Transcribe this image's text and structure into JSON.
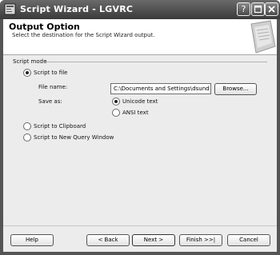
{
  "window": {
    "title": "Script Wizard - LGVRC"
  },
  "header": {
    "title": "Output Option",
    "subtitle": "Select the destination for the Script Wizard output."
  },
  "script_mode": {
    "group_label": "Script mode",
    "options": {
      "to_file": "Script to file",
      "to_clipboard": "Script to Clipboard",
      "to_query_window": "Script to New Query Window"
    },
    "selected": "to_file",
    "file_name_label": "File name:",
    "file_name_value": "C:\\Documents and Settings\\dsund",
    "browse_label": "Browse...",
    "save_as_label": "Save as:",
    "save_as": {
      "unicode": "Unicode text",
      "ansi": "ANSI text",
      "selected": "unicode"
    }
  },
  "footer": {
    "help": "Help",
    "back": "< Back",
    "next": "Next >",
    "finish": "Finish >>|",
    "cancel": "Cancel"
  }
}
